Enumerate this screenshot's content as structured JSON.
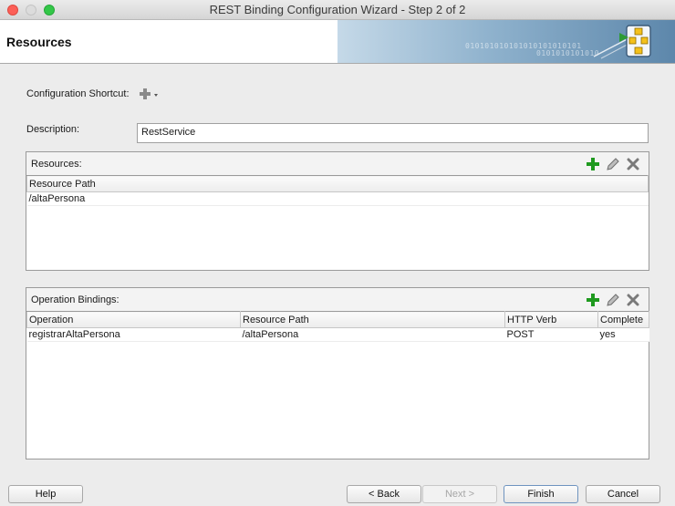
{
  "window": {
    "title": "REST Binding Configuration Wizard - Step 2 of 2"
  },
  "header": {
    "title": "Resources",
    "banner_bits_1": "010101010101010101010101",
    "banner_bits_2": "0101010101010"
  },
  "config": {
    "shortcut_label": "Configuration Shortcut:",
    "description_label": "Description:",
    "description_value": "RestService"
  },
  "resources": {
    "title": "Resources:",
    "columns": [
      "Resource Path"
    ],
    "rows": [
      [
        "/altaPersona"
      ]
    ]
  },
  "operations": {
    "title": "Operation Bindings:",
    "columns": [
      "Operation",
      "Resource Path",
      "HTTP Verb",
      "Complete"
    ],
    "rows": [
      [
        "registrarAltaPersona",
        "/altaPersona",
        "POST",
        "yes"
      ]
    ]
  },
  "buttons": {
    "help": "Help",
    "back": "< Back",
    "next": "Next >",
    "finish": "Finish",
    "cancel": "Cancel"
  },
  "colors": {
    "add": "#1f9a1f",
    "edit": "#7a7a7a",
    "delete": "#7a7a7a",
    "accent": "#5d87ab"
  },
  "icons": {
    "add": "add-icon",
    "edit": "pencil-icon",
    "delete": "delete-icon",
    "shortcut": "plus-dropdown-icon",
    "wizard": "wizard-icon"
  }
}
